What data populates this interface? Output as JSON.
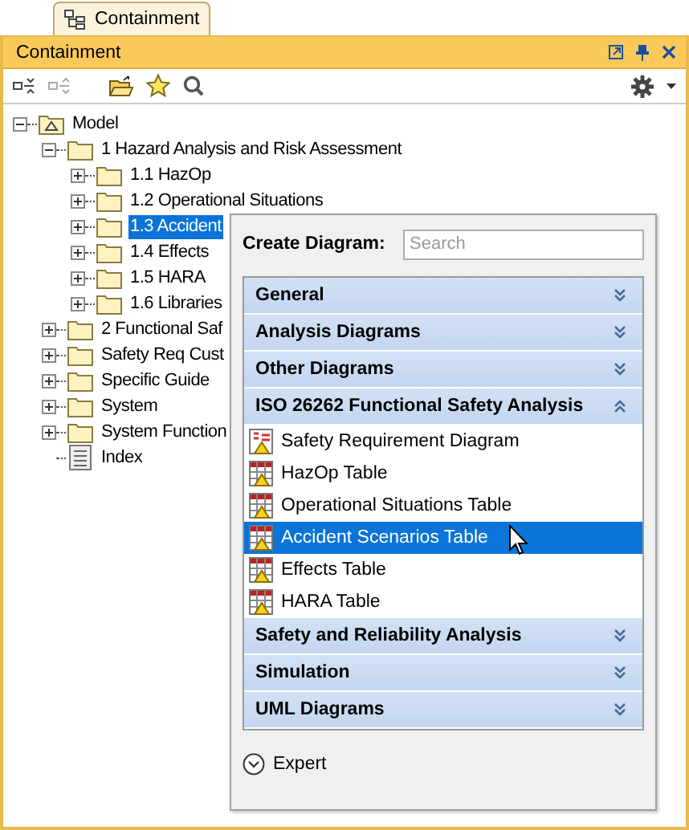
{
  "tab": {
    "label": "Containment",
    "selected": true
  },
  "panel": {
    "title": "Containment"
  },
  "tree": [
    {
      "label": "Model",
      "kind": "model",
      "expanded": true,
      "selected": false,
      "children": [
        {
          "label": "1 Hazard Analysis and Risk Assessment",
          "kind": "package",
          "expanded": true,
          "selected": false,
          "children": [
            {
              "label": "1.1 HazOp",
              "kind": "package",
              "expanded": false,
              "selected": false
            },
            {
              "label": "1.2 Operational Situations",
              "kind": "package",
              "expanded": false,
              "selected": false
            },
            {
              "label": "1.3 Accident",
              "kind": "package",
              "expanded": false,
              "selected": true
            },
            {
              "label": "1.4 Effects",
              "kind": "package",
              "expanded": false,
              "selected": false
            },
            {
              "label": "1.5 HARA",
              "kind": "package",
              "expanded": false,
              "selected": false
            },
            {
              "label": "1.6 Libraries",
              "kind": "package",
              "expanded": false,
              "selected": false
            }
          ]
        },
        {
          "label": "2 Functional Saf",
          "kind": "package",
          "expanded": false,
          "selected": false
        },
        {
          "label": "Safety Req Cust",
          "kind": "package",
          "expanded": false,
          "selected": false
        },
        {
          "label": "Specific Guide",
          "kind": "package",
          "expanded": false,
          "selected": false
        },
        {
          "label": "System",
          "kind": "package",
          "expanded": false,
          "selected": false
        },
        {
          "label": "System Function",
          "kind": "package",
          "expanded": false,
          "selected": false
        },
        {
          "label": "Index",
          "kind": "document",
          "selected": false
        }
      ]
    }
  ],
  "popup": {
    "label": "Create Diagram:",
    "search": {
      "placeholder": "Search"
    },
    "sections": [
      {
        "label": "General",
        "expanded": false
      },
      {
        "label": "Analysis Diagrams",
        "expanded": false
      },
      {
        "label": "Other Diagrams",
        "expanded": false
      },
      {
        "label": "ISO 26262 Functional Safety Analysis",
        "expanded": true,
        "items": [
          {
            "label": "Safety Requirement Diagram",
            "kind": "diagram",
            "selected": false
          },
          {
            "label": "HazOp Table",
            "kind": "table",
            "selected": false
          },
          {
            "label": "Operational Situations Table",
            "kind": "table",
            "selected": false
          },
          {
            "label": "Accident Scenarios Table",
            "kind": "table",
            "selected": true
          },
          {
            "label": "Effects Table",
            "kind": "table",
            "selected": false
          },
          {
            "label": "HARA Table",
            "kind": "table",
            "selected": false
          }
        ]
      },
      {
        "label": "Safety and Reliability Analysis",
        "expanded": false
      },
      {
        "label": "Simulation",
        "expanded": false
      },
      {
        "label": "UML Diagrams",
        "expanded": false
      }
    ],
    "expert": {
      "label": "Expert",
      "expanded": false
    }
  }
}
